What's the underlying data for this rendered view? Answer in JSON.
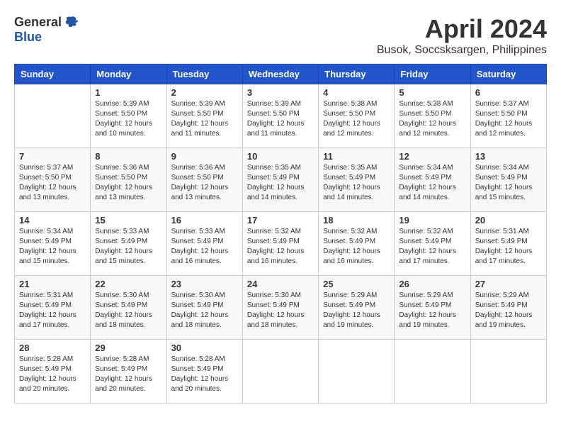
{
  "logo": {
    "general": "General",
    "blue": "Blue"
  },
  "title": "April 2024",
  "subtitle": "Busok, Soccsksargen, Philippines",
  "days_of_week": [
    "Sunday",
    "Monday",
    "Tuesday",
    "Wednesday",
    "Thursday",
    "Friday",
    "Saturday"
  ],
  "weeks": [
    [
      {
        "day": "",
        "info": ""
      },
      {
        "day": "1",
        "info": "Sunrise: 5:39 AM\nSunset: 5:50 PM\nDaylight: 12 hours\nand 10 minutes."
      },
      {
        "day": "2",
        "info": "Sunrise: 5:39 AM\nSunset: 5:50 PM\nDaylight: 12 hours\nand 11 minutes."
      },
      {
        "day": "3",
        "info": "Sunrise: 5:39 AM\nSunset: 5:50 PM\nDaylight: 12 hours\nand 11 minutes."
      },
      {
        "day": "4",
        "info": "Sunrise: 5:38 AM\nSunset: 5:50 PM\nDaylight: 12 hours\nand 12 minutes."
      },
      {
        "day": "5",
        "info": "Sunrise: 5:38 AM\nSunset: 5:50 PM\nDaylight: 12 hours\nand 12 minutes."
      },
      {
        "day": "6",
        "info": "Sunrise: 5:37 AM\nSunset: 5:50 PM\nDaylight: 12 hours\nand 12 minutes."
      }
    ],
    [
      {
        "day": "7",
        "info": "Sunrise: 5:37 AM\nSunset: 5:50 PM\nDaylight: 12 hours\nand 13 minutes."
      },
      {
        "day": "8",
        "info": "Sunrise: 5:36 AM\nSunset: 5:50 PM\nDaylight: 12 hours\nand 13 minutes."
      },
      {
        "day": "9",
        "info": "Sunrise: 5:36 AM\nSunset: 5:50 PM\nDaylight: 12 hours\nand 13 minutes."
      },
      {
        "day": "10",
        "info": "Sunrise: 5:35 AM\nSunset: 5:49 PM\nDaylight: 12 hours\nand 14 minutes."
      },
      {
        "day": "11",
        "info": "Sunrise: 5:35 AM\nSunset: 5:49 PM\nDaylight: 12 hours\nand 14 minutes."
      },
      {
        "day": "12",
        "info": "Sunrise: 5:34 AM\nSunset: 5:49 PM\nDaylight: 12 hours\nand 14 minutes."
      },
      {
        "day": "13",
        "info": "Sunrise: 5:34 AM\nSunset: 5:49 PM\nDaylight: 12 hours\nand 15 minutes."
      }
    ],
    [
      {
        "day": "14",
        "info": "Sunrise: 5:34 AM\nSunset: 5:49 PM\nDaylight: 12 hours\nand 15 minutes."
      },
      {
        "day": "15",
        "info": "Sunrise: 5:33 AM\nSunset: 5:49 PM\nDaylight: 12 hours\nand 15 minutes."
      },
      {
        "day": "16",
        "info": "Sunrise: 5:33 AM\nSunset: 5:49 PM\nDaylight: 12 hours\nand 16 minutes."
      },
      {
        "day": "17",
        "info": "Sunrise: 5:32 AM\nSunset: 5:49 PM\nDaylight: 12 hours\nand 16 minutes."
      },
      {
        "day": "18",
        "info": "Sunrise: 5:32 AM\nSunset: 5:49 PM\nDaylight: 12 hours\nand 16 minutes."
      },
      {
        "day": "19",
        "info": "Sunrise: 5:32 AM\nSunset: 5:49 PM\nDaylight: 12 hours\nand 17 minutes."
      },
      {
        "day": "20",
        "info": "Sunrise: 5:31 AM\nSunset: 5:49 PM\nDaylight: 12 hours\nand 17 minutes."
      }
    ],
    [
      {
        "day": "21",
        "info": "Sunrise: 5:31 AM\nSunset: 5:49 PM\nDaylight: 12 hours\nand 17 minutes."
      },
      {
        "day": "22",
        "info": "Sunrise: 5:30 AM\nSunset: 5:49 PM\nDaylight: 12 hours\nand 18 minutes."
      },
      {
        "day": "23",
        "info": "Sunrise: 5:30 AM\nSunset: 5:49 PM\nDaylight: 12 hours\nand 18 minutes."
      },
      {
        "day": "24",
        "info": "Sunrise: 5:30 AM\nSunset: 5:49 PM\nDaylight: 12 hours\nand 18 minutes."
      },
      {
        "day": "25",
        "info": "Sunrise: 5:29 AM\nSunset: 5:49 PM\nDaylight: 12 hours\nand 19 minutes."
      },
      {
        "day": "26",
        "info": "Sunrise: 5:29 AM\nSunset: 5:49 PM\nDaylight: 12 hours\nand 19 minutes."
      },
      {
        "day": "27",
        "info": "Sunrise: 5:29 AM\nSunset: 5:49 PM\nDaylight: 12 hours\nand 19 minutes."
      }
    ],
    [
      {
        "day": "28",
        "info": "Sunrise: 5:28 AM\nSunset: 5:49 PM\nDaylight: 12 hours\nand 20 minutes."
      },
      {
        "day": "29",
        "info": "Sunrise: 5:28 AM\nSunset: 5:49 PM\nDaylight: 12 hours\nand 20 minutes."
      },
      {
        "day": "30",
        "info": "Sunrise: 5:28 AM\nSunset: 5:49 PM\nDaylight: 12 hours\nand 20 minutes."
      },
      {
        "day": "",
        "info": ""
      },
      {
        "day": "",
        "info": ""
      },
      {
        "day": "",
        "info": ""
      },
      {
        "day": "",
        "info": ""
      }
    ]
  ]
}
